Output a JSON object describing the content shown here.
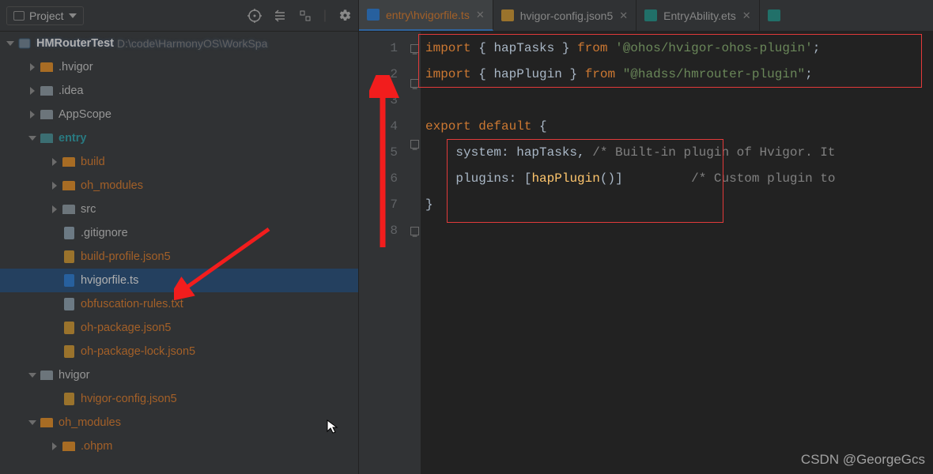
{
  "toolbar": {
    "project_label": "Project"
  },
  "tree": {
    "root": {
      "name": "HMRouterTest",
      "path": "D:\\code\\HarmonyOS\\WorkSpa"
    },
    "items": [
      {
        "name": ".hvigor",
        "type": "folder",
        "color": "orange",
        "depth": 1,
        "arrow": "right"
      },
      {
        "name": ".idea",
        "type": "folder",
        "color": "gray",
        "depth": 1,
        "arrow": "right"
      },
      {
        "name": "AppScope",
        "type": "folder",
        "color": "gray",
        "depth": 1,
        "arrow": "right"
      },
      {
        "name": "entry",
        "type": "folder",
        "color": "teal",
        "depth": 1,
        "arrow": "down",
        "bold": true
      },
      {
        "name": "build",
        "type": "folder",
        "color": "orange",
        "depth": 2,
        "arrow": "right",
        "textColor": "orange"
      },
      {
        "name": "oh_modules",
        "type": "folder",
        "color": "orange",
        "depth": 2,
        "arrow": "right",
        "textColor": "orange"
      },
      {
        "name": "src",
        "type": "folder",
        "color": "gray",
        "depth": 2,
        "arrow": "right"
      },
      {
        "name": ".gitignore",
        "type": "file",
        "icon": "txt",
        "depth": 2
      },
      {
        "name": "build-profile.json5",
        "type": "file",
        "icon": "json",
        "depth": 2,
        "textColor": "orange"
      },
      {
        "name": "hvigorfile.ts",
        "type": "file",
        "icon": "ts",
        "depth": 2,
        "selected": true
      },
      {
        "name": "obfuscation-rules.txt",
        "type": "file",
        "icon": "txt",
        "depth": 2,
        "textColor": "orange"
      },
      {
        "name": "oh-package.json5",
        "type": "file",
        "icon": "json",
        "depth": 2,
        "textColor": "orange"
      },
      {
        "name": "oh-package-lock.json5",
        "type": "file",
        "icon": "json",
        "depth": 2,
        "textColor": "orange"
      },
      {
        "name": "hvigor",
        "type": "folder",
        "color": "gray",
        "depth": 1,
        "arrow": "down"
      },
      {
        "name": "hvigor-config.json5",
        "type": "file",
        "icon": "json",
        "depth": 2,
        "textColor": "orange"
      },
      {
        "name": "oh_modules",
        "type": "folder",
        "color": "orange",
        "depth": 1,
        "arrow": "down",
        "textColor": "orange"
      },
      {
        "name": ".ohpm",
        "type": "folder",
        "color": "orange",
        "depth": 2,
        "arrow": "right",
        "textColor": "orange"
      }
    ]
  },
  "tabs": [
    {
      "label": "entry\\hvigorfile.ts",
      "icon": "ts",
      "active": true
    },
    {
      "label": "hvigor-config.json5",
      "icon": "json",
      "active": false
    },
    {
      "label": "EntryAbility.ets",
      "icon": "ets",
      "active": false
    }
  ],
  "code": {
    "lines": [
      {
        "n": 1,
        "html": "<span class='kw'>import</span> <span class='br'>{</span> <span class='id'>hapTasks</span> <span class='br'>}</span> <span class='kw'>from</span> <span class='str'>'@ohos/hvigor-ohos-plugin'</span><span class='br'>;</span>"
      },
      {
        "n": 2,
        "html": "<span class='kw'>import</span> <span class='br'>{</span> <span class='id'>hapPlugin</span> <span class='br'>}</span> <span class='kw'>from</span> <span class='str'>\"@hadss/hmrouter-plugin\"</span><span class='br'>;</span>"
      },
      {
        "n": 3,
        "html": ""
      },
      {
        "n": 4,
        "html": "<span class='kw'>export default</span> <span class='br'>{</span>"
      },
      {
        "n": 5,
        "html": "    <span class='id'>system</span>: <span class='id'>hapTasks</span><span class='br'>,</span> <span class='comment'>/* Built-in plugin of Hvigor. It</span>"
      },
      {
        "n": 6,
        "html": "    <span class='id'>plugins</span>: <span class='br'>[</span><span class='fn'>hapPlugin</span><span class='br'>()]</span>         <span class='comment'>/* Custom plugin to</span>"
      },
      {
        "n": 7,
        "html": "<span class='br'>}</span>"
      },
      {
        "n": 8,
        "html": ""
      }
    ]
  },
  "watermark": "CSDN @GeorgeGcs"
}
